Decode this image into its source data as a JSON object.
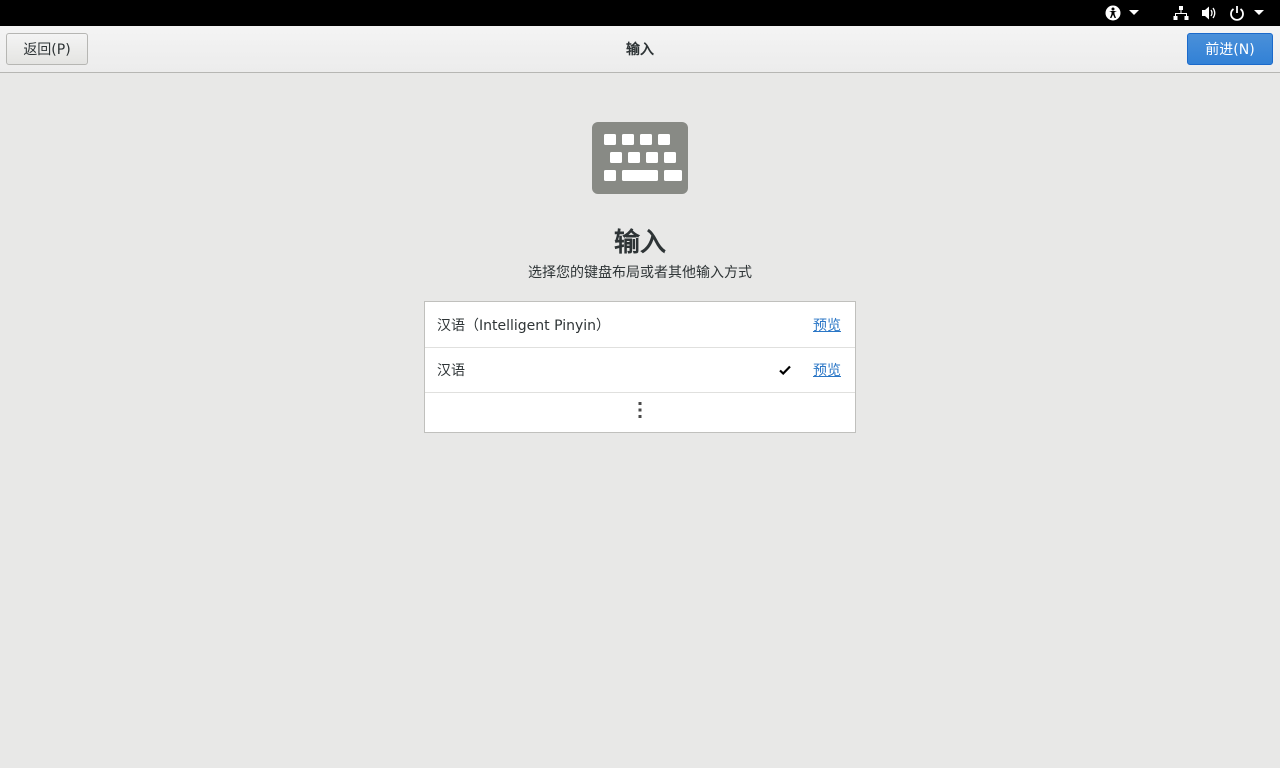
{
  "topbar": {
    "accessibility_icon": "accessibility-icon",
    "network_icon": "network-wired-icon",
    "volume_icon": "volume-icon",
    "power_icon": "power-icon"
  },
  "header": {
    "back_label": "返回(P)",
    "title": "输入",
    "next_label": "前进(N)"
  },
  "main": {
    "icon": "keyboard-icon",
    "title": "输入",
    "subtitle": "选择您的键盘布局或者其他输入方式"
  },
  "input_sources": [
    {
      "label": "汉语（Intelligent Pinyin）",
      "preview": "预览",
      "selected": false
    },
    {
      "label": "汉语",
      "preview": "预览",
      "selected": true
    }
  ],
  "more_icon": "view-more-icon",
  "colors": {
    "accent": "#3281d6",
    "link": "#2a76c6",
    "background": "#e8e8e7",
    "topbar": "#000000"
  }
}
